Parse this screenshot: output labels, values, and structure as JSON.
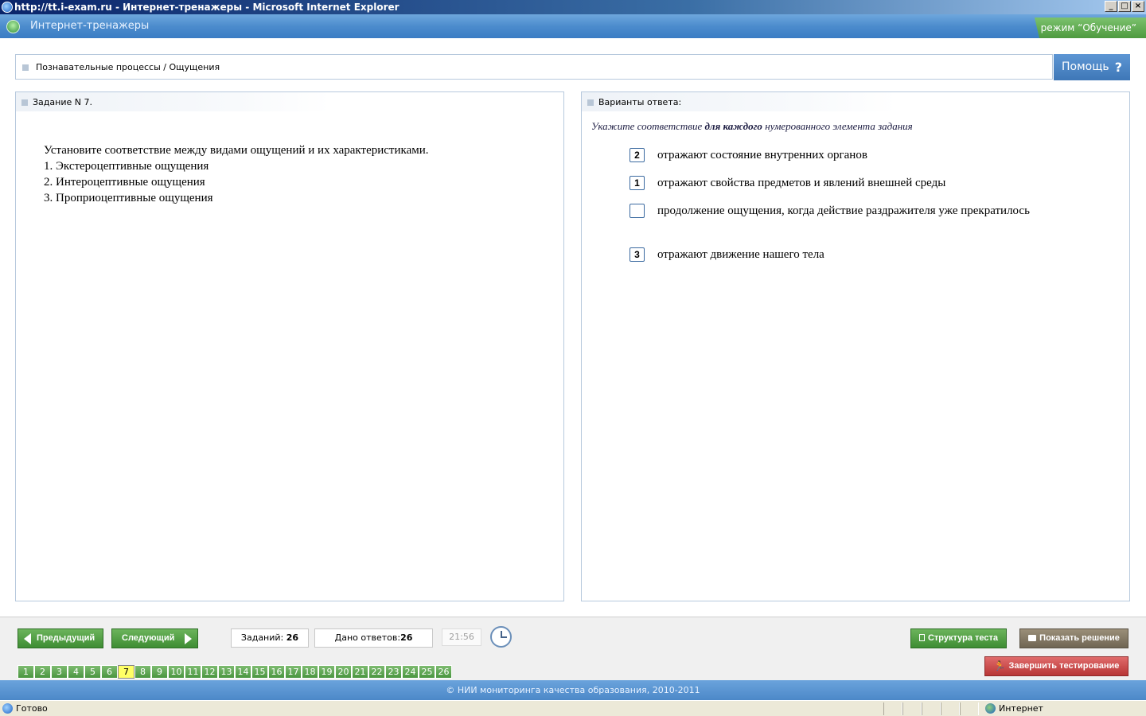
{
  "window": {
    "title": "http://tt.i-exam.ru - Интернет-тренажеры - Microsoft Internet Explorer",
    "min_label": "_",
    "max_label": "□",
    "close_label": "×"
  },
  "app": {
    "title": "Интернет-тренажеры",
    "mode": "режим “Обучение”"
  },
  "breadcrumb": "Познавательные процессы / Ощущения",
  "help": {
    "label": "Помощь",
    "icon_label": "?"
  },
  "task": {
    "header": "Задание N 7.",
    "lines": [
      "Установите соответствие между видами ощущений и их характеристиками.",
      "1. Экстероцептивные ощущения",
      "2. Интероцептивные ощущения",
      "3. Проприоцептивные ощущения"
    ]
  },
  "answers": {
    "header": "Варианты ответа:",
    "instruction_pre": "Укажите соответствие ",
    "instruction_bold": "для каждого",
    "instruction_post": " нумерованного элемента задания",
    "items": [
      {
        "value": "2",
        "text": "отражают состояние внутренних органов"
      },
      {
        "value": "1",
        "text": "отражают свойства предметов и явлений внешней среды"
      },
      {
        "value": "",
        "text": "продолжение ощущения, когда действие раздражителя уже прекратилось"
      },
      {
        "value": "3",
        "text": "отражают движение нашего тела"
      }
    ]
  },
  "nav": {
    "prev_label": "Предыдущий",
    "next_label": "Следующий",
    "tasks_label": "Заданий:",
    "tasks_count": "26",
    "answers_label": "Дано ответов:",
    "answers_count": "26",
    "time": "21:56",
    "structure_label": "Структура теста",
    "solution_label": "Показать решение",
    "finish_label": "Завершить тестирование",
    "pages": [
      "1",
      "2",
      "3",
      "4",
      "5",
      "6",
      "7",
      "8",
      "9",
      "10",
      "11",
      "12",
      "13",
      "14",
      "15",
      "16",
      "17",
      "18",
      "19",
      "20",
      "21",
      "22",
      "23",
      "24",
      "25",
      "26"
    ],
    "current_page": "7"
  },
  "footer": "© НИИ мониторинга качества образования, 2010-2011",
  "status": {
    "text": "Готово",
    "zone": "Интернет"
  },
  "colors": {
    "accent_blue": "#4c88c8",
    "nav_green": "#4a9640",
    "current_yellow": "#ffff66",
    "finish_red": "#b83636"
  }
}
